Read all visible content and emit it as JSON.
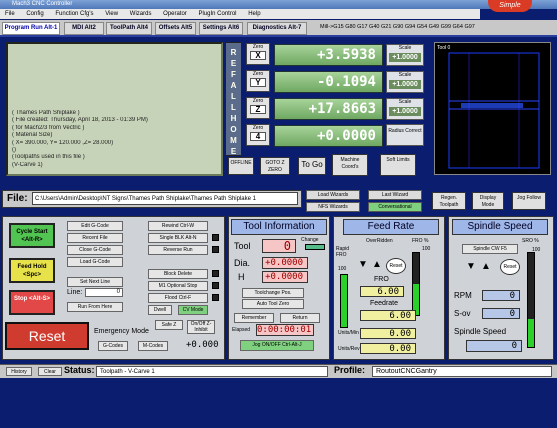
{
  "window": {
    "title": "Mach3 CNC Controller",
    "logo": "Simple"
  },
  "menu": [
    "File",
    "Config",
    "Function Cfg's",
    "View",
    "Wizards",
    "Operator",
    "PlugIn Control",
    "Help"
  ],
  "tabs": [
    "Program Run Alt-1",
    "MDI Alt2",
    "ToolPath Alt4",
    "Offsets Alt5",
    "Settings Alt6",
    "Diagnostics Alt-7"
  ],
  "gcode_modes": "Mill->G15  G80 G17 G40 G21 G90 G94 G54 G49 G99 G64 G97",
  "gcode_lines": [
    "( Thames Path Shiplake )",
    "( File created: Thursday, April 18, 2013 - 01:39 PM)",
    "( for Mach2/3 from Vectric )",
    "( Material Size)",
    "( X= 390.000, Y= 120.000 ,Z= 28.000)",
    "()",
    "(Toolpaths used in this file )",
    "(V-Carve 1)"
  ],
  "ref_all_home": [
    "R",
    "E",
    "F",
    "A",
    "L",
    "L",
    "H",
    "O",
    "M",
    "E"
  ],
  "axes": [
    {
      "zero_label": "Zero",
      "axis": "X",
      "dro": "+3.5938",
      "scale_label": "Scale",
      "scale": "+1.0000"
    },
    {
      "zero_label": "Zero",
      "axis": "Y",
      "dro": "-0.1094",
      "scale_label": "Scale",
      "scale": "+1.0000"
    },
    {
      "zero_label": "Zero",
      "axis": "Z",
      "dro": "+17.8663",
      "scale_label": "Scale",
      "scale": "+1.0000"
    },
    {
      "zero_label": "Zero",
      "axis": "4",
      "dro": "+0.0000",
      "scale_label": "Scale",
      "scale": "+1.0000"
    }
  ],
  "radius_correct": "Radius Correct",
  "dro_buttons": {
    "offline": "OFFLINE",
    "goto_zero": "GOTO Z ZERO",
    "to_go": "To Go",
    "machine_coords": "Machine Coord's",
    "soft_limits": "Soft Limits"
  },
  "toolpath": {
    "label": "Tool 0",
    "regen": "Regen. Toolpath",
    "display_mode": "Display Mode",
    "jog_follow": "Jog Follow"
  },
  "file": {
    "label": "File:",
    "path": "C:\\Users\\Admin\\Desktop\\NT Signs\\Thames Path Shiplake\\Thames Path Shiplake 1"
  },
  "wizards": {
    "load": "Load Wizards",
    "last": "Last Wizard",
    "nfs": "NFS Wizards",
    "conversational": "Conversational"
  },
  "cycle": {
    "start": "Cycle Start <Alt-R>",
    "feed_hold": "Feed Hold <Spc>",
    "stop": "Stop <Alt-S>",
    "reset": "Reset"
  },
  "gcode_buttons": {
    "edit": "Edit G-Code",
    "recent": "Recent File",
    "close": "Close G-Code",
    "load": "Load G-Code",
    "set_next": "Set Next Line",
    "line_label": "Line:",
    "line_value": "0",
    "run_from_here": "Run From Here",
    "rewind": "Rewind Ctrl-W",
    "single": "Single BLK Alt-N",
    "reverse": "Reverse Run",
    "block_delete": "Block Delete",
    "m1": "M1 Optional Stop",
    "flood": "Flood Ctrl-F",
    "dwell": "Dwell",
    "cv_mode": "CV Mode"
  },
  "safe_z": {
    "label": "Safe Z",
    "onoff": "On/Off Z-Inhibit",
    "value": "+0.000"
  },
  "emergency": "Emergency Mode",
  "gcodes_btn": "G-Codes",
  "mcodes_btn": "M-Codes",
  "tool_info": {
    "title": "Tool Information",
    "tool_label": "Tool",
    "tool": "0",
    "change": "Change",
    "dia_label": "Dia.",
    "dia": "+0.0000",
    "h_label": "H",
    "h": "+0.0000",
    "toolchange_pos": "Toolchange Pos.",
    "auto_zero": "Auto Tool Zero",
    "remember": "Remember",
    "return": "Return",
    "elapsed_label": "Elapsed",
    "elapsed": "0:00:00:01",
    "jog": "Jog ON/OFF Ctrl-Alt-J"
  },
  "feed": {
    "title": "Feed Rate",
    "override": "OverRidden",
    "fro_pct": "FRO %",
    "fro_pct_value": "100",
    "fro_label": "FRO",
    "fro": "6.00",
    "feedrate_label": "Feedrate",
    "feedrate": "6.00",
    "units_min_label": "Units/Min",
    "units_min": "0.00",
    "units_rev_label": "Units/Rev",
    "units_rev": "0.00",
    "reset": "Reset",
    "slider_label": "Rapid FRO",
    "slider_value": "100"
  },
  "spindle": {
    "title": "Spindle Speed",
    "cw": "Spindle CW F5",
    "sro_pct": "SRO %",
    "sro_value": "100",
    "rpm_label": "RPM",
    "rpm": "0",
    "sov_label": "S-ov",
    "sov": "0",
    "speed_label": "Spindle Speed",
    "speed": "0",
    "reset": "Reset"
  },
  "status": {
    "history": "History",
    "clear": "Clear",
    "label": "Status:",
    "text": "Toolpath - V-Carve 1",
    "profile_label": "Profile:",
    "profile": "RoutoutCNCGantry"
  }
}
